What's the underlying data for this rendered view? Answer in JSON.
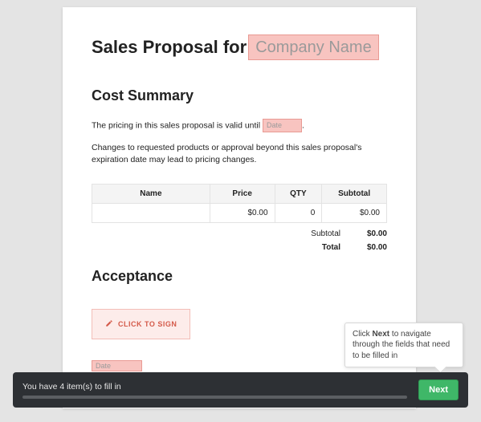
{
  "title": {
    "prefix": "Sales Proposal for",
    "company_placeholder": "Company Name"
  },
  "cost_summary": {
    "heading": "Cost Summary",
    "intro_prefix": "The pricing in this sales proposal is valid until",
    "date_placeholder": "Date",
    "intro_suffix": ".",
    "note": "Changes to requested products or approval beyond this sales proposal's expiration date may lead to pricing changes.",
    "columns": {
      "name": "Name",
      "price": "Price",
      "qty": "QTY",
      "subtotal": "Subtotal"
    },
    "rows": [
      {
        "name": "",
        "price": "$0.00",
        "qty": "0",
        "subtotal": "$0.00"
      }
    ],
    "totals": {
      "subtotal_label": "Subtotal",
      "subtotal_value": "$0.00",
      "total_label": "Total",
      "total_value": "$0.00"
    }
  },
  "acceptance": {
    "heading": "Acceptance",
    "sign_label": "CLICK TO SIGN",
    "date_placeholder": "Date"
  },
  "footer": {
    "message": "You have 4 item(s) to fill in",
    "next_label": "Next"
  },
  "tooltip": {
    "prefix": "Click ",
    "bold": "Next",
    "suffix": " to navigate through the fields that need to be filled in"
  }
}
